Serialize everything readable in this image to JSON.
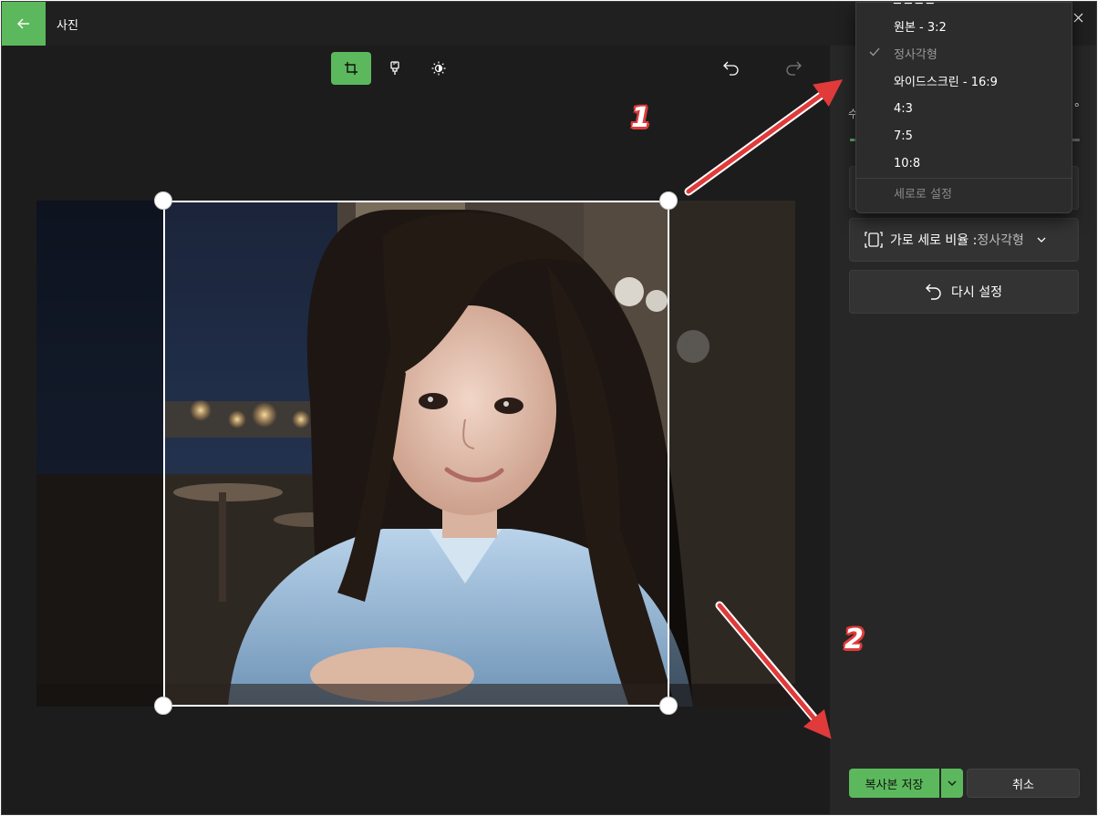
{
  "window": {
    "title": "사진"
  },
  "toolbar": {
    "tools": [
      {
        "icon": "crop-icon",
        "active": true
      },
      {
        "icon": "markup-icon",
        "active": false
      },
      {
        "icon": "brightness-icon",
        "active": false
      }
    ],
    "undo_icon": "undo-icon",
    "redo_icon": "redo-icon"
  },
  "photo": {
    "description_icon": "photo"
  },
  "panel": {
    "straighten_partial_label": "수",
    "degree_symbol": "°",
    "straighten_value_fraction": 0.02,
    "aspect_ratio_label": "가로 세로 비율 : ",
    "aspect_ratio_value": "정사각형",
    "reset_label": "다시 설정"
  },
  "dropdown": {
    "items": [
      {
        "label": "원본 - 3:2",
        "checked": false
      },
      {
        "label": "정사각형",
        "checked": true
      },
      {
        "label": "와이드스크린 - 16:9",
        "checked": false
      },
      {
        "label": "4:3",
        "checked": false
      },
      {
        "label": "7:5",
        "checked": false
      },
      {
        "label": "10:8",
        "checked": false
      }
    ],
    "orientation_label": "세로로 설정"
  },
  "footer": {
    "save_label": "복사본 저장",
    "cancel_label": "취소"
  },
  "annotations": {
    "one": "1",
    "two": "2"
  },
  "colors": {
    "accent": "#5cb85c",
    "arrow": "#e03a3a",
    "background": "#1e1e1e",
    "panel": "#272727"
  }
}
